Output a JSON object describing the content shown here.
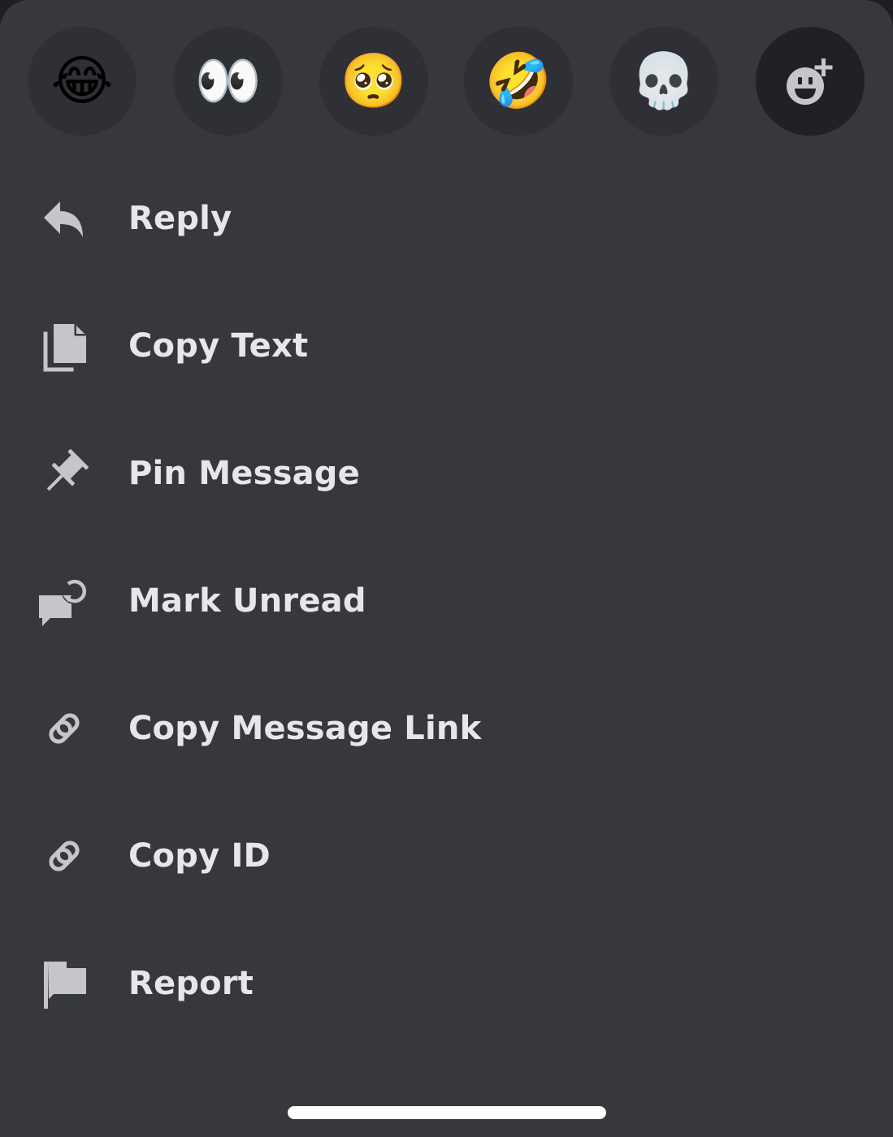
{
  "reactions": [
    {
      "name": "joy",
      "glyph": "😂"
    },
    {
      "name": "eyes",
      "glyph": "👀"
    },
    {
      "name": "pleading-face",
      "glyph": "🥺"
    },
    {
      "name": "rolling-on-floor-laughing",
      "glyph": "🤣"
    },
    {
      "name": "skull",
      "glyph": "💀"
    }
  ],
  "add_reaction": {
    "icon": "add-reaction-icon"
  },
  "menu": {
    "items": [
      {
        "label": "Reply",
        "icon": "reply-icon"
      },
      {
        "label": "Copy Text",
        "icon": "copy-icon"
      },
      {
        "label": "Pin Message",
        "icon": "pin-icon"
      },
      {
        "label": "Mark Unread",
        "icon": "mark-unread-icon"
      },
      {
        "label": "Copy Message Link",
        "icon": "link-icon"
      },
      {
        "label": "Copy ID",
        "icon": "link-icon"
      },
      {
        "label": "Report",
        "icon": "flag-icon"
      }
    ]
  },
  "colors": {
    "background": "#36383e",
    "emoji_button": "#2e3035",
    "add_button": "#202125",
    "text": "#e6e7ea",
    "icon": "#c4c6cb"
  }
}
